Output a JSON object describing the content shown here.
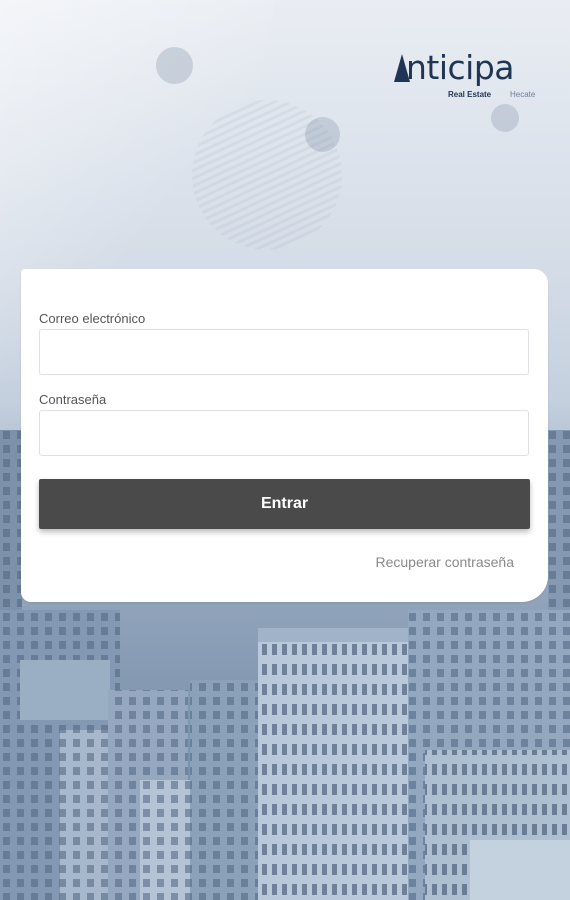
{
  "brand": {
    "name": "nticipa",
    "sub_line_1": "Real Estate",
    "sub_line_2": "Hecate"
  },
  "form": {
    "email_label": "Correo electrónico",
    "email_value": "",
    "password_label": "Contraseña",
    "password_value": "",
    "submit_label": "Entrar",
    "recover_label": "Recuperar contraseña"
  },
  "colors": {
    "brand_navy": "#1f3553",
    "button_bg": "#4a4a4a",
    "link_gray": "#8a8a8a"
  },
  "icons": {
    "logo": "anticipa-triangle-logo"
  }
}
